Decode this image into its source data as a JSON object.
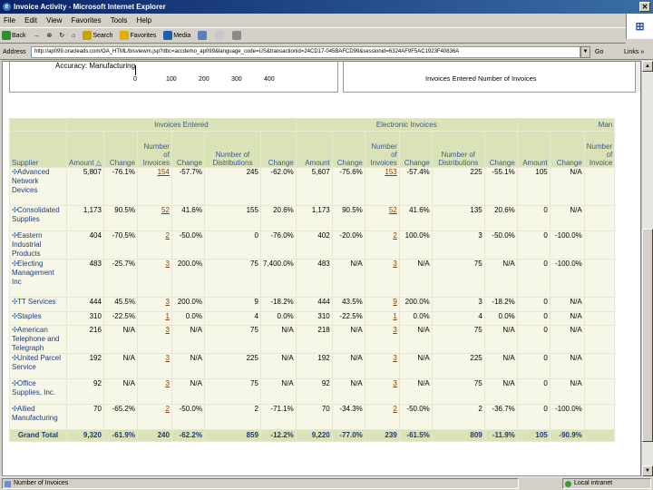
{
  "window": {
    "title": "Invoice Activity - Microsoft Internet Explorer",
    "close_glyph": "✕"
  },
  "menu": [
    "File",
    "Edit",
    "View",
    "Favorites",
    "Tools",
    "Help"
  ],
  "toolbar": {
    "back": "Back",
    "forward": "→",
    "stop": "⊗",
    "refresh": "↻",
    "home": "⌂",
    "search": "Search",
    "favorites": "Favorites",
    "media": "Media"
  },
  "address": {
    "label": "Address",
    "url": "http://ap099.oracleads.com/OA_HTML/bisviewm.jsp?dbc=accdemo_ap099&language_code=US&transactionid=24CD17-045BAFCD99&sessionid=6324AF9F5AC1923F40836A",
    "go": "Go",
    "links": "Links »"
  },
  "chart_strip": {
    "left_title": "Accuracy: Manufacturing",
    "ticks": [
      "0",
      "100",
      "200",
      "300",
      "400"
    ],
    "right_title": "Invoices Entered Number of Invoices"
  },
  "table": {
    "groups": [
      "Invoices Entered",
      "Electronic Invoices",
      "Man"
    ],
    "headers": {
      "supplier": "Supplier",
      "amount_sorted": "Amount △",
      "change": "Change",
      "num_invoices": "Number of Invoices",
      "num_distributions": "Number of Distributions",
      "amount": "Amount",
      "num_cut": "Number of Invoice"
    },
    "rows": [
      {
        "supplier": "Advanced Network Devices",
        "ie_amount": "5,807",
        "ie_change": "-76.1%",
        "ie_invoices": "154",
        "ie_inv_change": "-57.7%",
        "ie_dist": "245",
        "ie_dist_change": "-62.0%",
        "el_amount": "5,607",
        "el_change": "-75.6%",
        "el_invoices": "153",
        "el_inv_change": "-57.4%",
        "el_dist": "225",
        "el_dist_change": "-55.1%",
        "m_amount": "105",
        "m_change": "N/A",
        "m_invoices": ""
      },
      {
        "supplier": "Consolidated Supplies",
        "ie_amount": "1,173",
        "ie_change": "90.5%",
        "ie_invoices": "52",
        "ie_inv_change": "41.6%",
        "ie_dist": "155",
        "ie_dist_change": "20.6%",
        "el_amount": "1,173",
        "el_change": "90.5%",
        "el_invoices": "52",
        "el_inv_change": "41.6%",
        "el_dist": "135",
        "el_dist_change": "20.6%",
        "m_amount": "0",
        "m_change": "N/A",
        "m_invoices": ""
      },
      {
        "supplier": "Eastern Industrial Products",
        "ie_amount": "404",
        "ie_change": "-70.5%",
        "ie_invoices": "2",
        "ie_inv_change": "-50.0%",
        "ie_dist": "0",
        "ie_dist_change": "-76.0%",
        "el_amount": "402",
        "el_change": "-20.0%",
        "el_invoices": "2",
        "el_inv_change": "100.0%",
        "el_dist": "3",
        "el_dist_change": "-50.0%",
        "m_amount": "0",
        "m_change": "-100.0%",
        "m_invoices": ""
      },
      {
        "supplier": "Electing Management Inc",
        "ie_amount": "483",
        "ie_change": "-25.7%",
        "ie_invoices": "3",
        "ie_inv_change": "200.0%",
        "ie_dist": "75",
        "ie_dist_change": "7,400.0%",
        "el_amount": "483",
        "el_change": "N/A",
        "el_invoices": "3",
        "el_inv_change": "N/A",
        "el_dist": "75",
        "el_dist_change": "N/A",
        "m_amount": "0",
        "m_change": "-100.0%",
        "m_invoices": ""
      },
      {
        "supplier": "TT Services",
        "ie_amount": "444",
        "ie_change": "45.5%",
        "ie_invoices": "3",
        "ie_inv_change": "200.0%",
        "ie_dist": "9",
        "ie_dist_change": "-18.2%",
        "el_amount": "444",
        "el_change": "43.5%",
        "el_invoices": "9",
        "el_inv_change": "200.0%",
        "el_dist": "3",
        "el_dist_change": "-18.2%",
        "m_amount": "0",
        "m_change": "N/A",
        "m_invoices": ""
      },
      {
        "supplier": "Staples",
        "ie_amount": "310",
        "ie_change": "-22.5%",
        "ie_invoices": "1",
        "ie_inv_change": "0.0%",
        "ie_dist": "4",
        "ie_dist_change": "0.0%",
        "el_amount": "310",
        "el_change": "-22.5%",
        "el_invoices": "1",
        "el_inv_change": "0.0%",
        "el_dist": "4",
        "el_dist_change": "0.0%",
        "m_amount": "0",
        "m_change": "N/A",
        "m_invoices": ""
      },
      {
        "supplier": "American Telephone and Telegraph",
        "ie_amount": "216",
        "ie_change": "N/A",
        "ie_invoices": "3",
        "ie_inv_change": "N/A",
        "ie_dist": "75",
        "ie_dist_change": "N/A",
        "el_amount": "218",
        "el_change": "N/A",
        "el_invoices": "3",
        "el_inv_change": "N/A",
        "el_dist": "75",
        "el_dist_change": "N/A",
        "m_amount": "0",
        "m_change": "N/A",
        "m_invoices": ""
      },
      {
        "supplier": "United Parcel Service",
        "ie_amount": "192",
        "ie_change": "N/A",
        "ie_invoices": "3",
        "ie_inv_change": "N/A",
        "ie_dist": "225",
        "ie_dist_change": "N/A",
        "el_amount": "192",
        "el_change": "N/A",
        "el_invoices": "3",
        "el_inv_change": "N/A",
        "el_dist": "225",
        "el_dist_change": "N/A",
        "m_amount": "0",
        "m_change": "N/A",
        "m_invoices": ""
      },
      {
        "supplier": "Office Supplies, Inc.",
        "ie_amount": "92",
        "ie_change": "N/A",
        "ie_invoices": "3",
        "ie_inv_change": "N/A",
        "ie_dist": "75",
        "ie_dist_change": "N/A",
        "el_amount": "92",
        "el_change": "N/A",
        "el_invoices": "3",
        "el_inv_change": "N/A",
        "el_dist": "75",
        "el_dist_change": "N/A",
        "m_amount": "0",
        "m_change": "N/A",
        "m_invoices": ""
      },
      {
        "supplier": "Allied Manufacturing",
        "ie_amount": "70",
        "ie_change": "-65.2%",
        "ie_invoices": "2",
        "ie_inv_change": "-50.0%",
        "ie_dist": "2",
        "ie_dist_change": "-71.1%",
        "el_amount": "70",
        "el_change": "-34.3%",
        "el_invoices": "2",
        "el_inv_change": "-50.0%",
        "el_dist": "2",
        "el_dist_change": "-36.7%",
        "m_amount": "0",
        "m_change": "-100.0%",
        "m_invoices": ""
      }
    ],
    "total": {
      "label": "Grand Total",
      "ie_amount": "9,320",
      "ie_change": "-61.9%",
      "ie_invoices": "240",
      "ie_inv_change": "-62.2%",
      "ie_dist": "859",
      "ie_dist_change": "-12.2%",
      "el_amount": "9,220",
      "el_change": "-77.0%",
      "el_invoices": "239",
      "el_inv_change": "-61.5%",
      "el_dist": "809",
      "el_dist_change": "-11.9%",
      "m_amount": "105",
      "m_change": "-90.9%",
      "m_invoices": ""
    }
  },
  "status": {
    "left": "Number of Invoices",
    "right": "Local intranet"
  },
  "colors": {
    "header_bg": "#d9e3b7",
    "row_bg": "#f7f7e7",
    "header_text": "#3c5a8c",
    "link_text": "#8b3a00",
    "titlebar": "#0a246a"
  }
}
